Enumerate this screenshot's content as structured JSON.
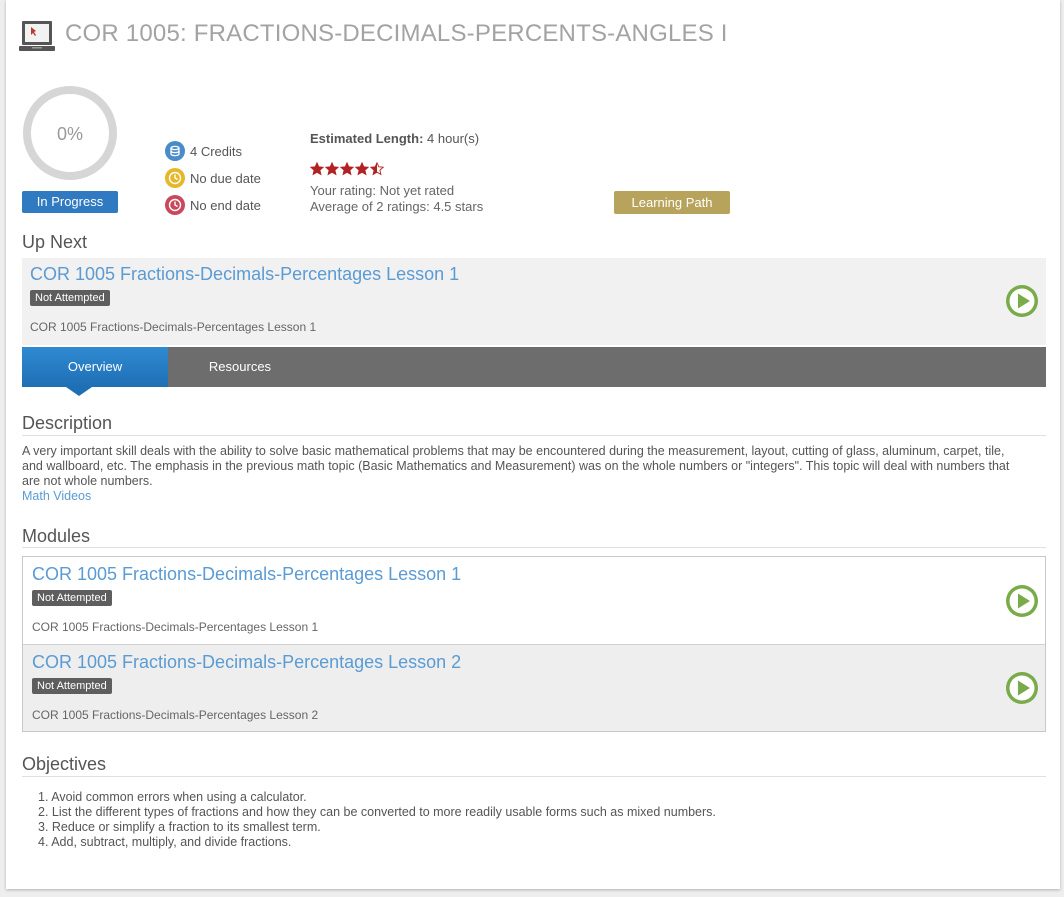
{
  "course": {
    "title": "COR 1005: FRACTIONS-DECIMALS-PERCENTS-ANGLES I",
    "icon": "laptop-course-icon"
  },
  "progress": {
    "percent_label": "0%",
    "percent": 0,
    "status": "In Progress"
  },
  "meta": {
    "credits": "4 Credits",
    "due": "No due date",
    "end": "No end date"
  },
  "estimate": {
    "label": "Estimated Length:",
    "value": "4 hour(s)"
  },
  "rating": {
    "stars": 4.5,
    "your_rating": "Your rating: Not yet rated",
    "average": "Average of 2 ratings: 4.5 stars"
  },
  "learning_path_label": "Learning Path",
  "up_next": {
    "heading": "Up Next",
    "title": "COR 1005 Fractions-Decimals-Percentages Lesson 1",
    "status": "Not Attempted",
    "subtitle": "COR 1005 Fractions-Decimals-Percentages Lesson 1"
  },
  "tabs": [
    {
      "label": "Overview",
      "active": true
    },
    {
      "label": "Resources",
      "active": false
    }
  ],
  "description": {
    "heading": "Description",
    "text": "A very important skill deals with the ability to solve basic mathematical problems that may be encountered during the measurement, layout, cutting of glass, aluminum, carpet, tile, and wallboard, etc. The emphasis in the previous math topic (Basic Mathematics and Measurement) was on the whole numbers or \"integers\". This topic will deal with numbers that are not whole numbers.",
    "link": "Math Videos"
  },
  "modules": {
    "heading": "Modules",
    "items": [
      {
        "title": "COR 1005 Fractions-Decimals-Percentages Lesson 1",
        "status": "Not Attempted",
        "subtitle": "COR 1005 Fractions-Decimals-Percentages Lesson 1"
      },
      {
        "title": "COR 1005 Fractions-Decimals-Percentages Lesson 2",
        "status": "Not Attempted",
        "subtitle": "COR 1005 Fractions-Decimals-Percentages Lesson 2"
      }
    ]
  },
  "objectives": {
    "heading": "Objectives",
    "items": [
      "1. Avoid common errors when using a calculator.",
      "2. List the different types of fractions and how they can be converted to more readily usable forms such as mixed numbers.",
      "3. Reduce or simplify a fraction to its smallest term.",
      "4. Add, subtract, multiply, and divide fractions."
    ]
  },
  "colors": {
    "accent_blue": "#2f7ac0",
    "link_blue": "#5a9bd4",
    "play_green": "#7aab4a",
    "learning_path_gold": "#b8a35c",
    "star_red": "#b22222"
  }
}
